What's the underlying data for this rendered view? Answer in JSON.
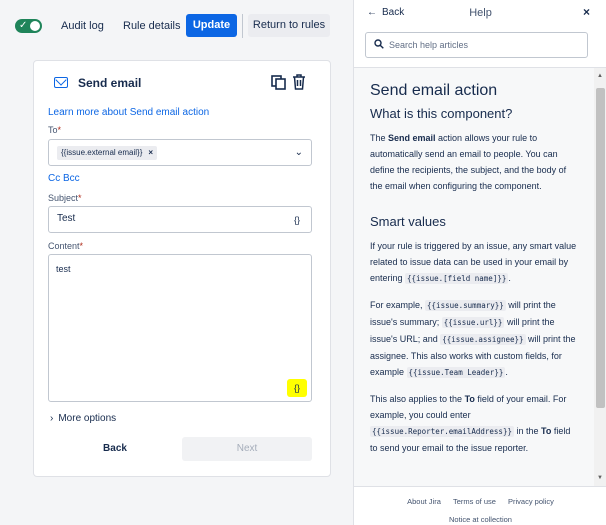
{
  "toolbar": {
    "audit_log": "Audit log",
    "rule_details": "Rule details",
    "update": "Update",
    "return_to_rules": "Return to rules"
  },
  "card": {
    "title": "Send email",
    "learn_more": "Learn more about Send email action",
    "to_label": "To",
    "to_chip": "{{issue.external email}}",
    "cc_bcc": "Cc  Bcc",
    "subject_label": "Subject",
    "subject_value": "Test",
    "content_label": "Content",
    "content_value": "test",
    "smart_icon": "{}",
    "more_options": "More options",
    "back": "Back",
    "next": "Next",
    "required_mark": "*"
  },
  "help": {
    "back": "Back",
    "title": "Help",
    "close": "×",
    "search_placeholder": "Search help articles",
    "h1": "Send email action",
    "h2_what": "What is this component?",
    "p1_bold": "Send email",
    "p1_pre": "The ",
    "p1_post": " action allows your rule to automatically send an email to people. You can define the recipients, the subject, and the body of the email when configuring the component.",
    "h2_smart": "Smart values",
    "p2_text": "If your rule is triggered by an issue, any smart value related to issue data can be used in your email by entering ",
    "p2_code": "{{issue.[field name]}}",
    "p2_end": ".",
    "p3_a": "For example, ",
    "p3_code1": "{{issue.summary}}",
    "p3_b": " will print the issue's summary; ",
    "p3_code2": "{{issue.url}}",
    "p3_c": " will print the issue's URL; and ",
    "p3_code3": "{{issue.assignee}}",
    "p3_d": " will print the assignee. This also works with custom fields, for example ",
    "p3_code4": "{{issue.Team Leader}}",
    "p3_e": ".",
    "p4_a": "This also applies to the ",
    "p4_bold1": "To",
    "p4_b": " field of your email. For example, you could enter ",
    "p4_code": "{{issue.Reporter.emailAddress}}",
    "p4_c": " in the ",
    "p4_bold2": "To",
    "p4_d": " field to send your email to the issue reporter.",
    "footer_links": [
      "About Jira",
      "Terms of use",
      "Privacy policy"
    ],
    "footer_notice": "Notice at collection"
  },
  "colors": {
    "primary": "#0c66e4",
    "toggle_on": "#1f845a",
    "highlight": "#ffff00"
  },
  "icons": [
    "check-icon",
    "mail-icon",
    "copy-icon",
    "trash-icon",
    "chevron-down-icon",
    "chevron-right-icon",
    "arrow-left-icon",
    "close-icon",
    "search-icon"
  ]
}
